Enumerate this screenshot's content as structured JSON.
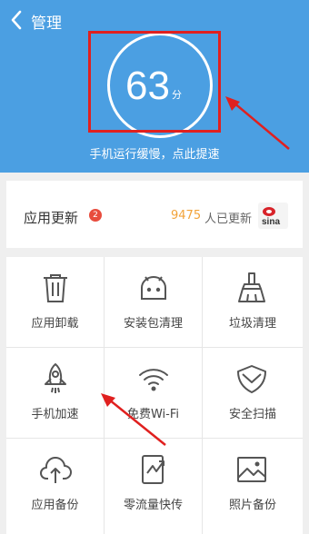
{
  "header": {
    "title": "管理",
    "score": "63",
    "score_unit": "分",
    "status": "手机运行缓慢，点此提速"
  },
  "update_card": {
    "label": "应用更新",
    "badge": "2",
    "count": "9475",
    "text": "人已更新",
    "logo": "sina"
  },
  "tools": [
    {
      "label": "应用卸载",
      "icon": "trash-icon"
    },
    {
      "label": "安装包清理",
      "icon": "android-icon"
    },
    {
      "label": "垃圾清理",
      "icon": "broom-icon"
    },
    {
      "label": "手机加速",
      "icon": "rocket-icon"
    },
    {
      "label": "免费Wi-Fi",
      "icon": "wifi-icon"
    },
    {
      "label": "安全扫描",
      "icon": "shield-icon"
    },
    {
      "label": "应用备份",
      "icon": "cloud-upload-icon"
    },
    {
      "label": "零流量快传",
      "icon": "transfer-icon"
    },
    {
      "label": "照片备份",
      "icon": "photo-icon"
    }
  ],
  "colors": {
    "header_bg": "#4b9fe2",
    "badge": "#e84c3d",
    "count": "#f2a33a",
    "annotation": "#e0201f"
  }
}
